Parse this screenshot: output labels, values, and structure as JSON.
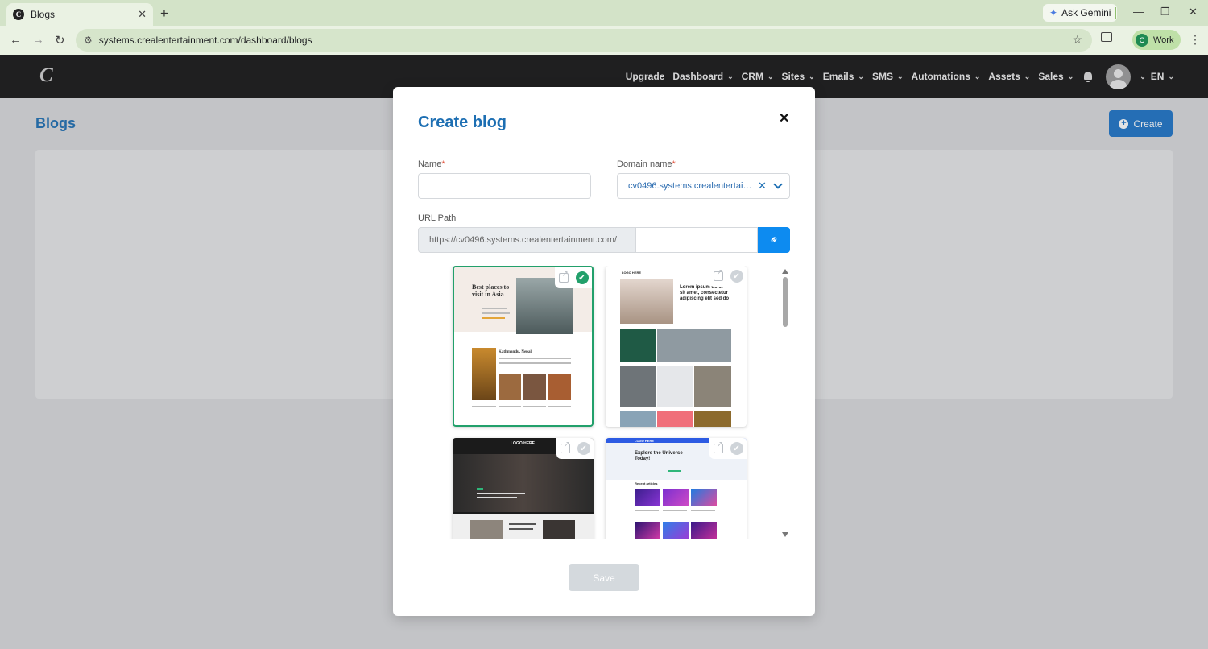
{
  "browser": {
    "tab_title": "Blogs",
    "new_tab": "+",
    "url": "systems.crealentertainment.com/dashboard/blogs",
    "gemini_label": "Ask Gemini",
    "profile_label": "Work",
    "profile_initial": "C"
  },
  "header": {
    "logo": "C",
    "nav": [
      "Upgrade",
      "Dashboard",
      "CRM",
      "Sites",
      "Emails",
      "SMS",
      "Automations",
      "Assets",
      "Sales"
    ],
    "lang": "EN"
  },
  "page": {
    "title": "Blogs",
    "create_label": "Create"
  },
  "modal": {
    "title": "Create blog",
    "name_label": "Name",
    "name_value": "",
    "domain_label": "Domain name",
    "domain_value": "cv0496.systems.crealentertainment.com",
    "required_mark": "*",
    "url_path_label": "URL Path",
    "url_prefix": "https://cv0496.systems.crealentertainment.com/",
    "url_value": "",
    "save_label": "Save",
    "templates": [
      {
        "heading": "Best places to visit in Asia",
        "sub": "Kathmandu, Nepal",
        "selected": true
      },
      {
        "heading": "Lorem ipsum dolor sit amet, consectetur adipiscing elit sed do",
        "logo": "LOGO HERE",
        "selected": false
      },
      {
        "heading": "LOGO HERE",
        "selected": false
      },
      {
        "heading": "Explore the Universe Today!",
        "sub": "Recent articles",
        "logo": "LOGO HERE",
        "selected": false
      }
    ]
  },
  "colors": {
    "accent": "#1d6fb3",
    "selected": "#22a06b",
    "header_bg": "#161616"
  }
}
